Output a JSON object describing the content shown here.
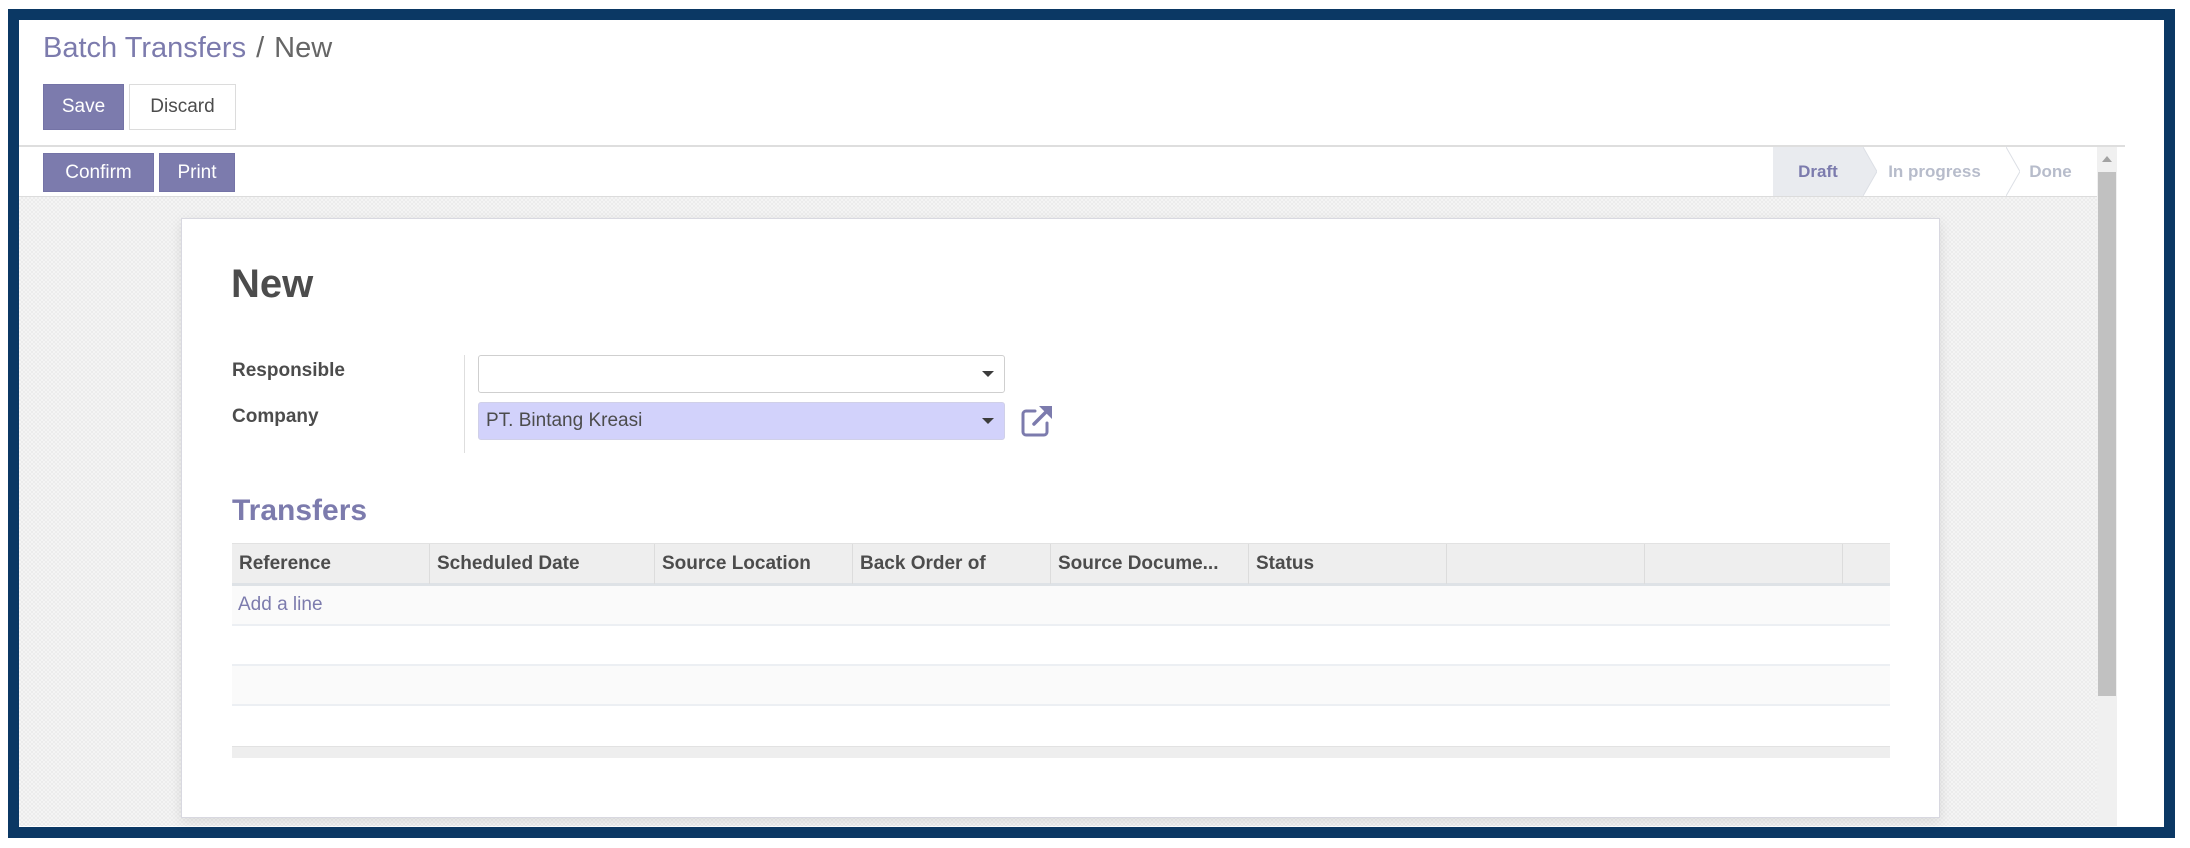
{
  "breadcrumb": {
    "parent": "Batch Transfers",
    "separator": "/",
    "current": "New"
  },
  "actions": {
    "save_label": "Save",
    "discard_label": "Discard",
    "confirm_label": "Confirm",
    "print_label": "Print"
  },
  "statusbar": {
    "steps": [
      {
        "label": "Draft",
        "active": true
      },
      {
        "label": "In progress",
        "active": false
      },
      {
        "label": "Done",
        "active": false
      }
    ]
  },
  "form": {
    "title": "New",
    "fields": {
      "responsible": {
        "label": "Responsible",
        "value": ""
      },
      "company": {
        "label": "Company",
        "value": "PT. Bintang Kreasi"
      }
    }
  },
  "transfers": {
    "section_title": "Transfers",
    "columns": [
      "Reference",
      "Scheduled Date",
      "Source Location",
      "Back Order of",
      "Source Docume...",
      "Status",
      "",
      "",
      ""
    ],
    "add_line_label": "Add a line",
    "rows": []
  },
  "icons": {
    "external_link": "external-link-icon",
    "dropdown_caret": "caret-down-icon",
    "scroll_up": "scroll-up-arrow-icon"
  },
  "colors": {
    "brand": "#7c7bad",
    "frame": "#0b3864",
    "company_field_bg": "#d2d2fb",
    "status_active_bg": "#e9ebef",
    "status_inactive_text": "#b7bccb"
  }
}
